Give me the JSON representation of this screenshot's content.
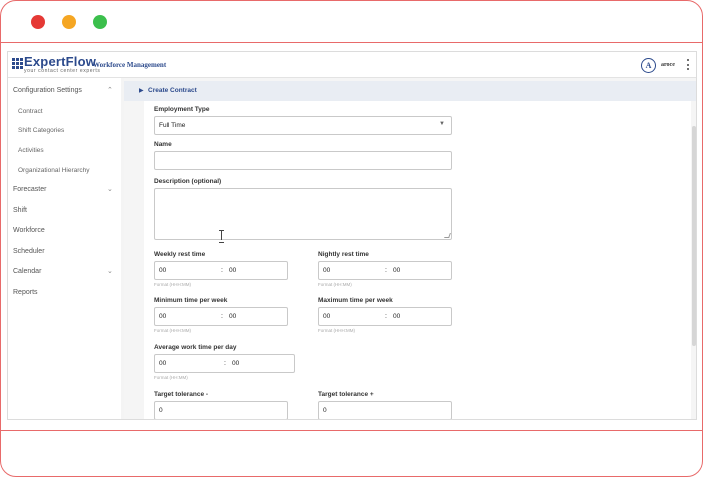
{
  "header": {
    "logo_name": "ExpertFlow",
    "logo_tagline": "your contact center experts",
    "app_title": "Workforce Management",
    "avatar_initial": "A",
    "username": "aroce"
  },
  "sidebar": {
    "items": [
      {
        "label": "Configuration Settings",
        "expanded": true
      },
      {
        "label": "Contract"
      },
      {
        "label": "Shift Categories"
      },
      {
        "label": "Activities"
      },
      {
        "label": "Organizational Hierarchy"
      },
      {
        "label": "Forecaster"
      },
      {
        "label": "Shift"
      },
      {
        "label": "Workforce"
      },
      {
        "label": "Scheduler"
      },
      {
        "label": "Calendar"
      },
      {
        "label": "Reports"
      }
    ]
  },
  "section": {
    "title": "Create Contract"
  },
  "form": {
    "employment_type_label": "Employment Type",
    "employment_type_value": "Full Time",
    "name_label": "Name",
    "name_value": "",
    "description_label": "Description (optional)",
    "description_value": "",
    "weekly_rest_label": "Weekly rest time",
    "weekly_rest_hours": "00",
    "weekly_rest_minutes": "00",
    "weekly_rest_hint": "Format (HHH:MM)",
    "nightly_rest_label": "Nightly rest time",
    "nightly_rest_hours": "00",
    "nightly_rest_minutes": "00",
    "nightly_rest_hint": "Format (HH:MM)",
    "min_week_label": "Minimum time per week",
    "min_week_hours": "00",
    "min_week_minutes": "00",
    "min_week_hint": "Format (HHH:MM)",
    "max_week_label": "Maximum time per week",
    "max_week_hours": "00",
    "max_week_minutes": "00",
    "max_week_hint": "Format (HHH:MM)",
    "avg_day_label": "Average work time per day",
    "avg_day_hours": "00",
    "avg_day_minutes": "00",
    "avg_day_hint": "Format (HH:MM)",
    "tol_minus_label": "Target tolerance -",
    "tol_minus_value": "0",
    "tol_plus_label": "Target tolerance +",
    "tol_plus_value": "0",
    "colon": ":"
  },
  "colors": {
    "brand": "#2c4a8c",
    "window_red": "#e53935",
    "window_yellow": "#f5a623",
    "window_green": "#3bbf4c",
    "frame_line": "#e86a6a"
  }
}
